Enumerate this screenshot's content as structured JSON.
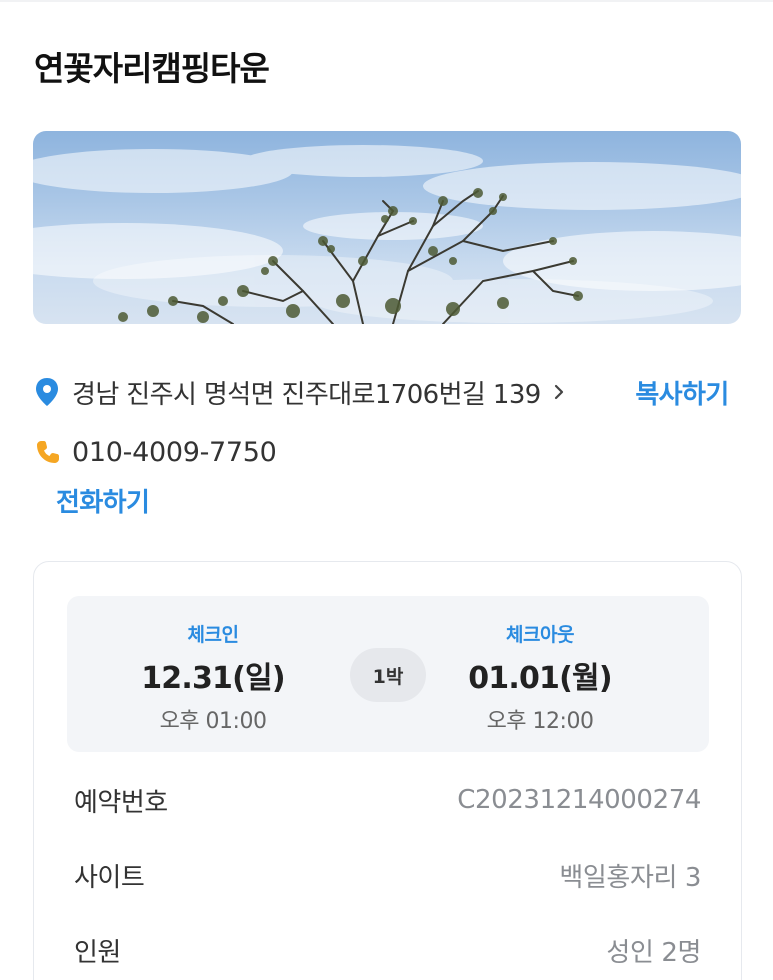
{
  "header": {
    "title": "연꽃자리캠핑타운"
  },
  "location": {
    "address": "경남 진주시 명석면 진주대로1706번길 139",
    "copy_label": "복사하기",
    "phone": "010-4009-7750",
    "call_label": "전화하기"
  },
  "icons": {
    "pin": "location-pin-icon",
    "phone": "phone-icon",
    "chevron": "chevron-right-icon"
  },
  "colors": {
    "accent": "#2a8be0",
    "pin": "#2a8be0",
    "phone": "#f5a623"
  },
  "reservation": {
    "checkin": {
      "label": "체크인",
      "date": "12.31(일)",
      "time": "오후 01:00"
    },
    "nights": "1박",
    "checkout": {
      "label": "체크아웃",
      "date": "01.01(월)",
      "time": "오후 12:00"
    },
    "details": [
      {
        "label": "예약번호",
        "value": "C20231214000274"
      },
      {
        "label": "사이트",
        "value": "백일홍자리 3"
      },
      {
        "label": "인원",
        "value": "성인 2명"
      }
    ]
  }
}
